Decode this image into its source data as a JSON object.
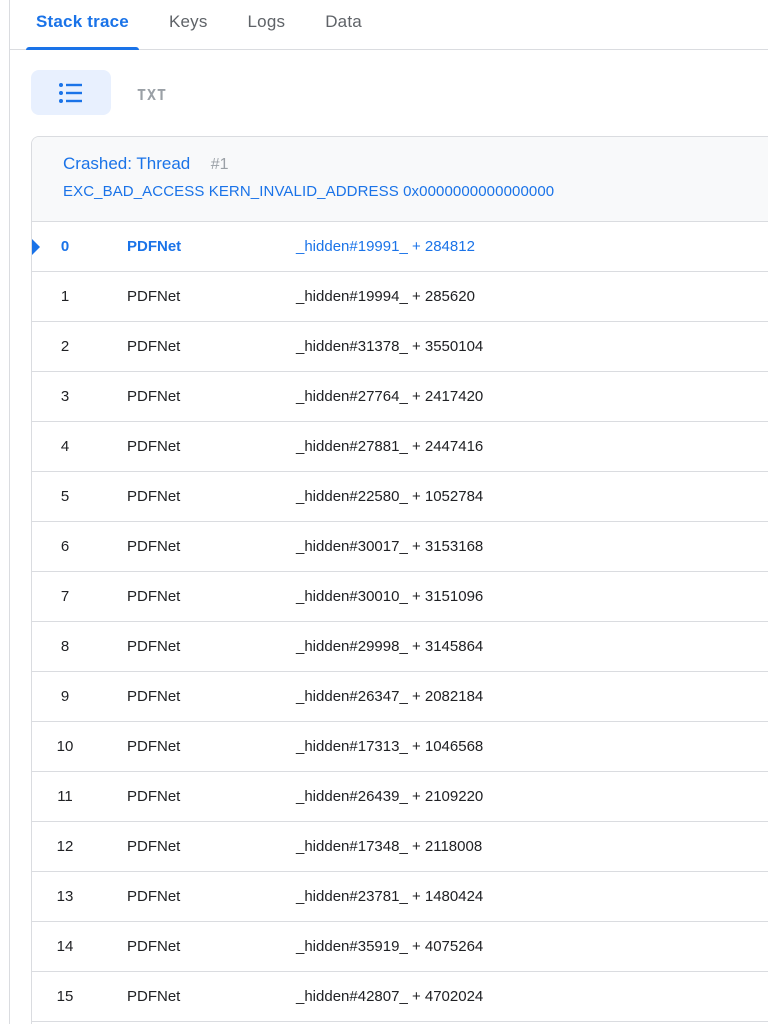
{
  "tabs": [
    {
      "label": "Stack trace",
      "active": true
    },
    {
      "label": "Keys",
      "active": false
    },
    {
      "label": "Logs",
      "active": false
    },
    {
      "label": "Data",
      "active": false
    }
  ],
  "view_toggle": {
    "list_icon": "list-icon",
    "txt_label": "TXT"
  },
  "crash": {
    "title": "Crashed: Thread",
    "thread_number": "#1",
    "reason": "EXC_BAD_ACCESS KERN_INVALID_ADDRESS 0x0000000000000000"
  },
  "colors": {
    "accent": "#1a73e8",
    "muted": "#9aa0a6",
    "divider": "#dadce0",
    "header_bg": "#f8f9fa",
    "selected_btn_bg": "#e8f0fe"
  },
  "frames": [
    {
      "index": "0",
      "library": "PDFNet",
      "symbol": "_hidden#19991_ + 284812",
      "selected": true
    },
    {
      "index": "1",
      "library": "PDFNet",
      "symbol": "_hidden#19994_ + 285620"
    },
    {
      "index": "2",
      "library": "PDFNet",
      "symbol": "_hidden#31378_ + 3550104"
    },
    {
      "index": "3",
      "library": "PDFNet",
      "symbol": "_hidden#27764_ + 2417420"
    },
    {
      "index": "4",
      "library": "PDFNet",
      "symbol": "_hidden#27881_ + 2447416"
    },
    {
      "index": "5",
      "library": "PDFNet",
      "symbol": "_hidden#22580_ + 1052784"
    },
    {
      "index": "6",
      "library": "PDFNet",
      "symbol": "_hidden#30017_ + 3153168"
    },
    {
      "index": "7",
      "library": "PDFNet",
      "symbol": "_hidden#30010_ + 3151096"
    },
    {
      "index": "8",
      "library": "PDFNet",
      "symbol": "_hidden#29998_ + 3145864"
    },
    {
      "index": "9",
      "library": "PDFNet",
      "symbol": "_hidden#26347_ + 2082184"
    },
    {
      "index": "10",
      "library": "PDFNet",
      "symbol": "_hidden#17313_ + 1046568"
    },
    {
      "index": "11",
      "library": "PDFNet",
      "symbol": "_hidden#26439_ + 2109220"
    },
    {
      "index": "12",
      "library": "PDFNet",
      "symbol": "_hidden#17348_ + 2118008"
    },
    {
      "index": "13",
      "library": "PDFNet",
      "symbol": "_hidden#23781_ + 1480424"
    },
    {
      "index": "14",
      "library": "PDFNet",
      "symbol": "_hidden#35919_ + 4075264"
    },
    {
      "index": "15",
      "library": "PDFNet",
      "symbol": "_hidden#42807_ + 4702024"
    }
  ]
}
